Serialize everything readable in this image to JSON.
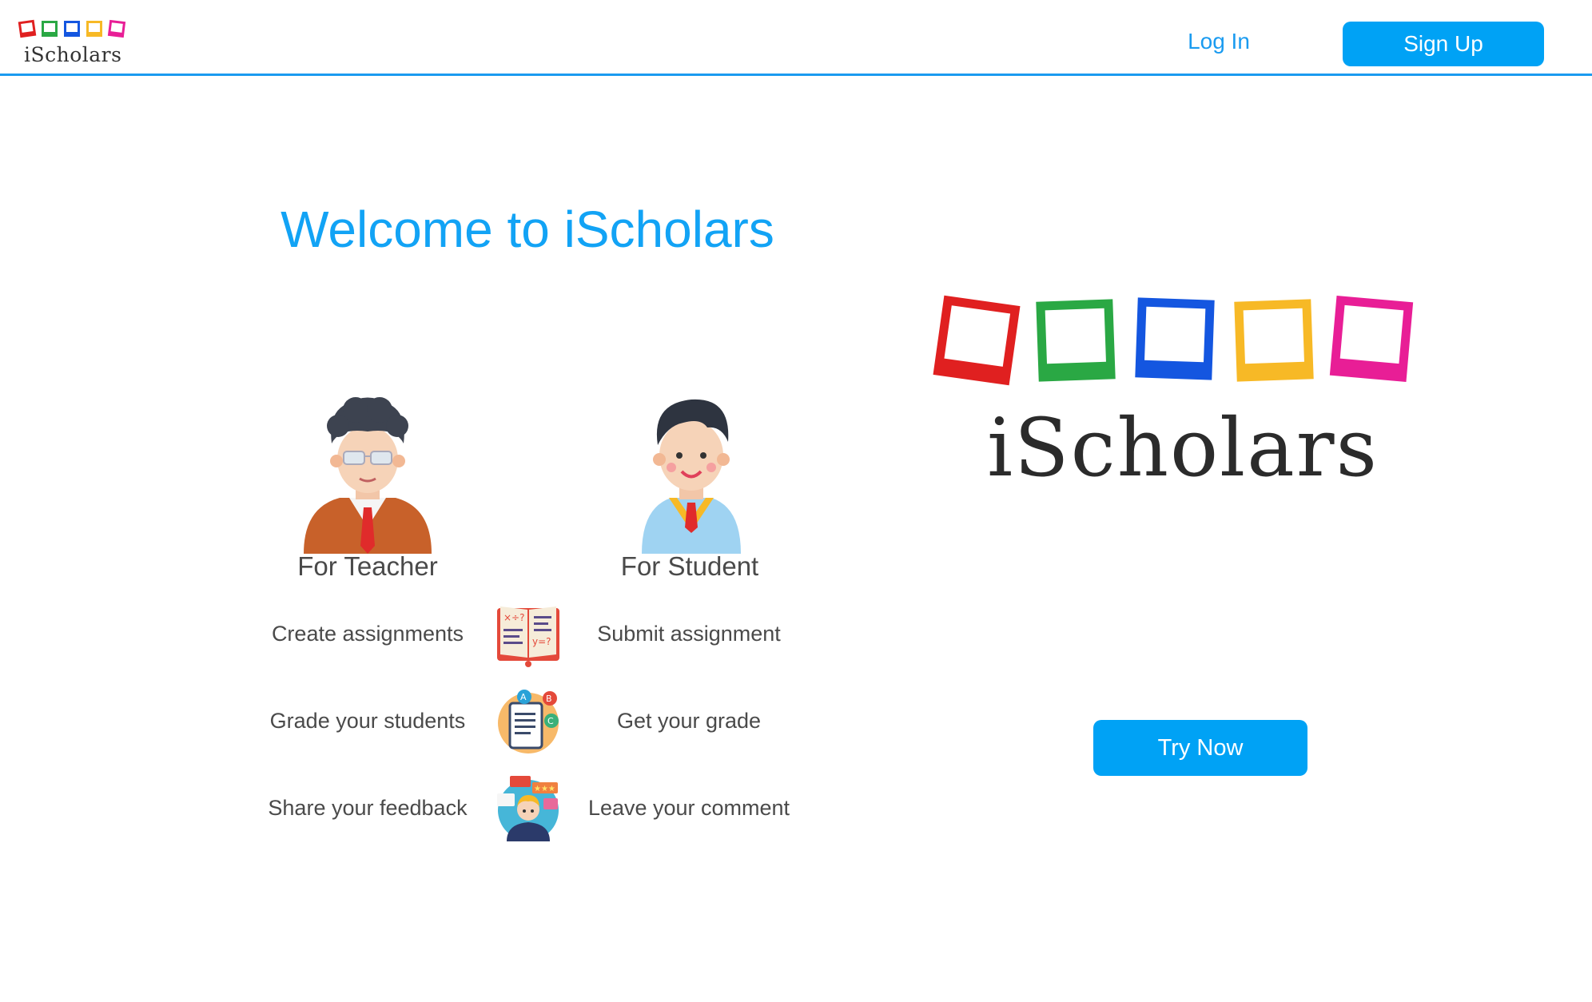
{
  "header": {
    "logo_text": "iScholars",
    "login_label": "Log In",
    "signup_label": "Sign Up"
  },
  "main": {
    "welcome_title": "Welcome to iScholars",
    "teacher_label": "For Teacher",
    "student_label": "For Student",
    "features": [
      {
        "teacher": "Create assignments",
        "icon": "open-book-icon",
        "student": "Submit assignment"
      },
      {
        "teacher": "Grade your students",
        "icon": "graded-paper-icon",
        "student": "Get your grade"
      },
      {
        "teacher": "Share your feedback",
        "icon": "feedback-person-icon",
        "student": "Leave your comment"
      }
    ]
  },
  "hero": {
    "logo_text": "iScholars",
    "try_now_label": "Try Now"
  },
  "colors": {
    "accent": "#00a2f5",
    "frame_red": "#e02020",
    "frame_green": "#2aa844",
    "frame_blue": "#1456e0",
    "frame_yellow": "#f7b926",
    "frame_pink": "#e81e96"
  }
}
